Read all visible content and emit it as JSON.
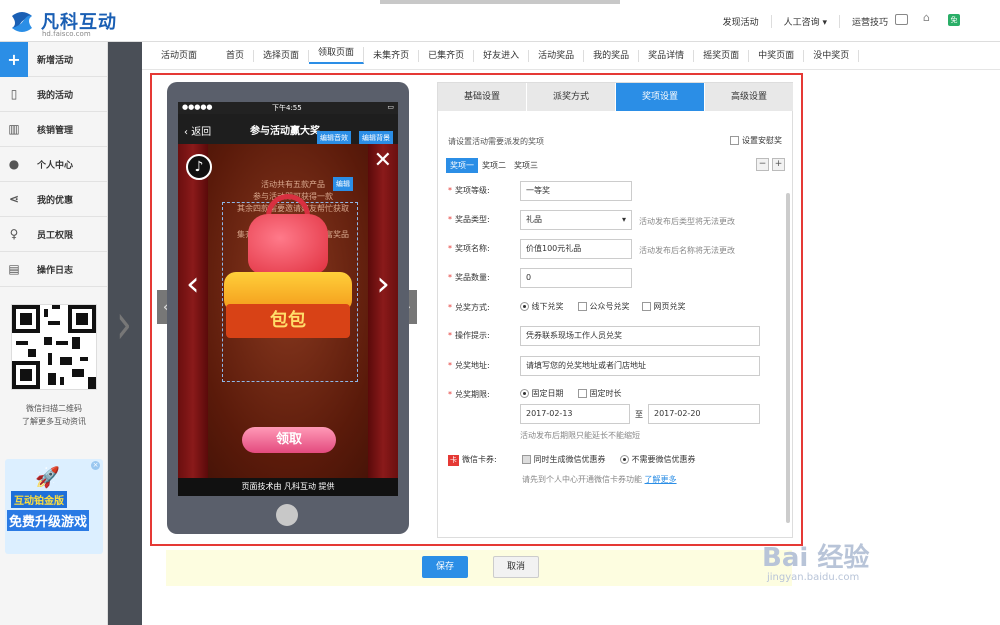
{
  "header": {
    "logo_text": "凡科互动",
    "logo_sub": "hd.faisco.com",
    "nav": [
      "发现活动",
      "人工咨询 ▾",
      "运营技巧"
    ],
    "badge": "免"
  },
  "sidebar": {
    "items": [
      {
        "label": "新增活动",
        "icon": "plus-icon"
      },
      {
        "label": "我的活动",
        "icon": "phone-icon"
      },
      {
        "label": "核销管理",
        "icon": "barcode-icon"
      },
      {
        "label": "个人中心",
        "icon": "user-icon"
      },
      {
        "label": "我的优惠",
        "icon": "share-icon"
      },
      {
        "label": "员工权限",
        "icon": "key-icon"
      },
      {
        "label": "操作日志",
        "icon": "clipboard-icon"
      }
    ],
    "qr_text_1": "微信扫描二维码",
    "qr_text_2": "了解更多互动资讯",
    "ad_line1": "互动铂金版",
    "ad_line2": "免费升级游戏"
  },
  "page_tabs": [
    "活动页面",
    "首页",
    "选择页面",
    "领取页面",
    "未集齐页",
    "已集齐页",
    "好友进入",
    "活动奖品",
    "我的奖品",
    "奖品详情",
    "摇奖页面",
    "中奖页面",
    "没中奖页"
  ],
  "phone": {
    "time": "下午4:55",
    "back": "返回",
    "title": "参与活动赢大奖",
    "edit_sound": "编辑音效",
    "edit_bg": "编辑背景",
    "edit": "编辑",
    "stage_line1": "活动共有五款产品",
    "stage_line2": "参与活动即可获得一款",
    "stage_line3": "其余四款需要邀请好友帮忙获取",
    "stage_line4": "集齐五款即有机会赢得丰富奖品",
    "ribbon": "包包",
    "claim": "领取",
    "footer": "页面技术由 凡科互动 提供"
  },
  "panel": {
    "tabs": [
      "基础设置",
      "派奖方式",
      "奖项设置",
      "高级设置"
    ],
    "hint": "请设置活动需要派发的奖项",
    "safety_label": "设置安慰奖",
    "prize_tabs": [
      "奖项一",
      "奖项二",
      "奖项三"
    ],
    "fields": {
      "level_label": "奖项等级:",
      "level_value": "一等奖",
      "type_label": "奖品类型:",
      "type_value": "礼品",
      "type_note": "活动发布后类型将无法更改",
      "name_label": "奖项名称:",
      "name_value": "价值100元礼品",
      "name_note": "活动发布后名称将无法更改",
      "qty_label": "奖品数量:",
      "qty_value": "0",
      "method_label": "兑奖方式:",
      "method_opt1": "线下兑奖",
      "method_opt2": "公众号兑奖",
      "method_opt3": "网页兑奖",
      "tip_label": "操作提示:",
      "tip_value": "凭券联系现场工作人员兑奖",
      "addr_label": "兑奖地址:",
      "addr_value": "请填写您的兑奖地址或者门店地址",
      "period_label": "兑奖期限:",
      "period_opt1": "固定日期",
      "period_opt2": "固定时长",
      "date_start": "2017-02-13",
      "date_to": "至",
      "date_end": "2017-02-20",
      "period_note": "活动发布后期限只能延长不能缩短",
      "card_label": "微信卡券:",
      "card_opt1": "同时生成微信优惠券",
      "card_opt2": "不需要微信优惠券",
      "card_note": "请先到个人中心开通微信卡券功能",
      "card_link": "了解更多"
    }
  },
  "buttons": {
    "save": "保存",
    "cancel": "取消"
  },
  "watermark": {
    "main": "Bai 经验",
    "sub": "jingyan.baidu.com"
  },
  "colors": {
    "accent": "#2b8ee6",
    "highlight_border": "#e53935",
    "required": "#e53935"
  }
}
